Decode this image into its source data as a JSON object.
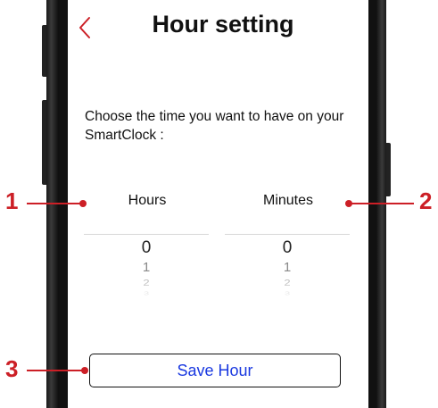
{
  "header": {
    "title": "Hour setting",
    "back_icon": "chevron-left-icon"
  },
  "instructions": "Choose the time you want to have on your SmartClock :",
  "pickers": {
    "hours": {
      "label": "Hours",
      "values": [
        "0",
        "1",
        "2",
        "3"
      ]
    },
    "minutes": {
      "label": "Minutes",
      "values": [
        "0",
        "1",
        "2",
        "3"
      ]
    }
  },
  "save_button": {
    "label": "Save Hour"
  },
  "callouts": [
    "1",
    "2",
    "3"
  ],
  "colors": {
    "accent": "#cc1f26",
    "button_text": "#1a39e0",
    "text": "#111111"
  }
}
